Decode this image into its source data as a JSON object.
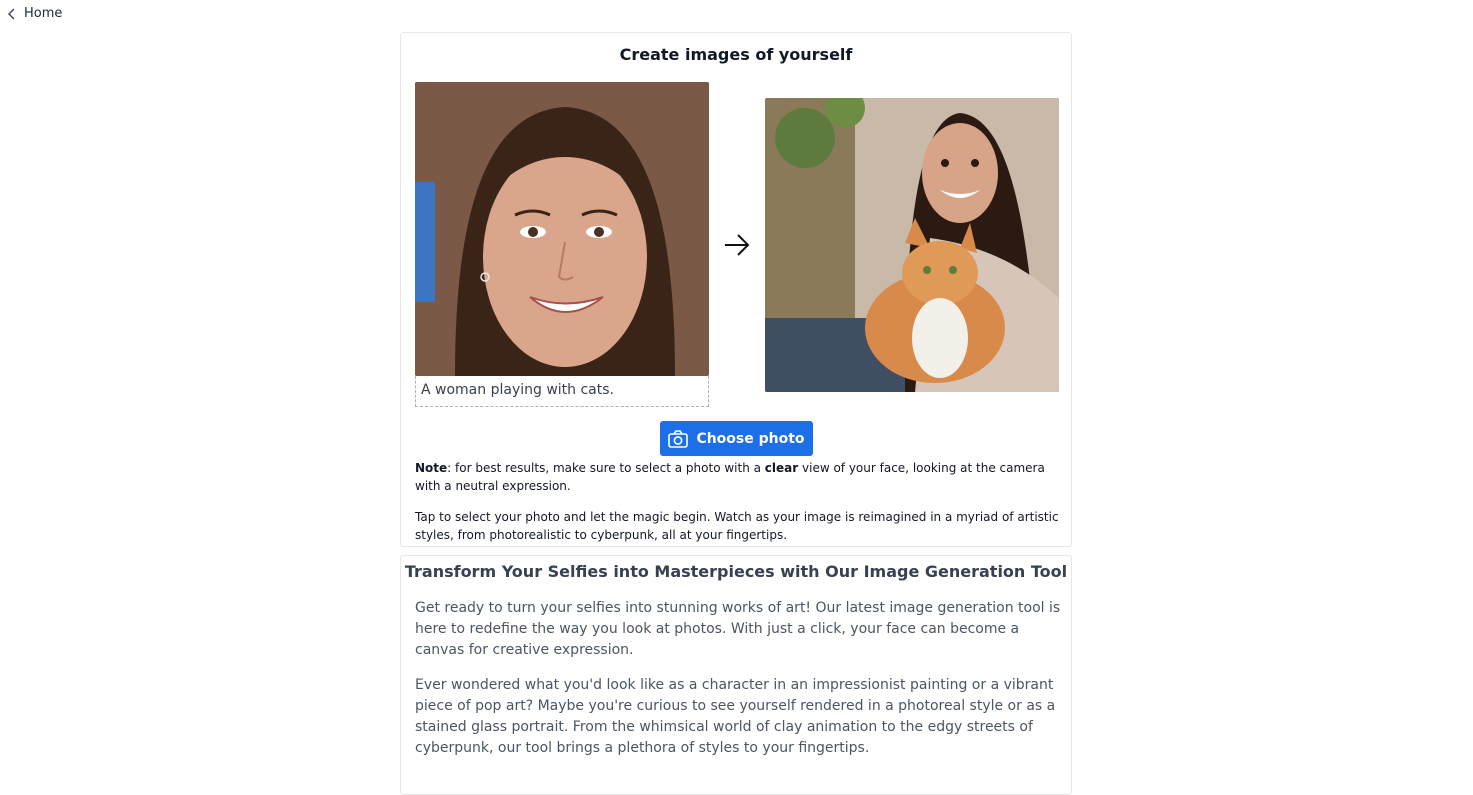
{
  "nav": {
    "home_label": "Home"
  },
  "card": {
    "title": "Create images of yourself",
    "prompt_text": "A woman playing with cats.",
    "choose_button_label": "Choose photo",
    "note_label": "Note",
    "note_part1": ": for best results, make sure to select a photo with a ",
    "note_bold": "clear",
    "note_part2": " view of your face, looking at the camera with a neutral expression.",
    "tap_text": "Tap to select your photo and let the magic begin. Watch as your image is reimagined in a myriad of artistic styles, from photorealistic to cyberpunk, all at your fingertips."
  },
  "article": {
    "title": "Transform Your Selfies into Masterpieces with Our Image Generation Tool",
    "paragraphs": [
      "Get ready to turn your selfies into stunning works of art! Our latest image generation tool is here to redefine the way you look at photos. With just a click, your face can become a canvas for creative expression.",
      "Ever wondered what you'd look like as a character in an impressionist painting or a vibrant piece of pop art? Maybe you're curious to see yourself rendered in a photoreal style or as a stained glass portrait. From the whimsical world of clay animation to the edgy streets of cyberpunk, our tool brings a plethora of styles to your fingertips."
    ]
  },
  "icons": {
    "back": "chevron-left-icon",
    "arrow": "arrow-right-icon",
    "camera": "camera-icon"
  },
  "colors": {
    "button": "#1d6fe8",
    "border": "#e5e7eb"
  }
}
